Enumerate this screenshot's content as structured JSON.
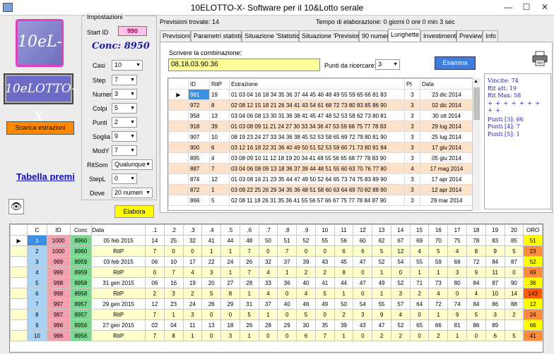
{
  "window": {
    "title": "10ELOTTO-X- Software per il 10&Lotto  serale",
    "minimize": "—",
    "maximize": "☐",
    "close": "✕"
  },
  "logo_top": "10eL-X",
  "conc_label": "Conc: 8950",
  "logo_brand": "10eLOTTO-X",
  "scarica_label": "Scarica estrazioni",
  "tabella_premi": "Tabella premi",
  "eye_icon": "👁",
  "impostazioni": {
    "legend": "Impostazioni",
    "start_id_label": "Start ID",
    "start_id": "990",
    "fields": [
      {
        "label": "Casi",
        "value": "10"
      },
      {
        "label": "Step",
        "value": "7"
      },
      {
        "label": "Numeri",
        "value": "3"
      },
      {
        "label": "Colpi",
        "value": "5"
      },
      {
        "label": "Punti",
        "value": "2"
      },
      {
        "label": "Soglia",
        "value": "9"
      },
      {
        "label": "ModY",
        "value": "7"
      },
      {
        "label": "RitSom",
        "value": "Qualunque"
      },
      {
        "label": "StepL",
        "value": "0"
      },
      {
        "label": "Dove",
        "value": "20 numeri"
      }
    ],
    "elabora": "Elabora"
  },
  "info": {
    "previsioni": "Previsioni trovate: 14",
    "tempo": "Tempo di elaborazione: 0 giorni 0 ore 0 min 3 sec"
  },
  "tabs": [
    "Previsioni",
    "Parametri statistici",
    "Situazione 'Statistici'",
    "Situazione 'Previsioni'",
    "90 numeri",
    "Lunghette",
    "Investimenti",
    "Preview",
    "Info"
  ],
  "lunghette": {
    "combo_label": "Scrivere la combinazione:",
    "combo_value": "08.18.03.90.36",
    "punti_label": "Punti da ricercare:",
    "punti_value": "3",
    "esamina": "Esamina",
    "headers": [
      "ID",
      "RitP",
      "Estrazione",
      "Pt",
      "Data"
    ],
    "rows": [
      [
        "981",
        "19",
        "01 03 04 16 18 34 35 36 37 44 45 46 48 49 55 59 65 66 81 83",
        "3",
        "23 dic 2014"
      ],
      [
        "972",
        "8",
        "02 08 12 15 18 21 26 34 41 43 54 61 68 72 73 80 83 85 86 90",
        "3",
        "02 dic 2014"
      ],
      [
        "958",
        "13",
        "03 04 06 08 13 30 31 36 38 41 45 47 48 52 53 58 62 73 80 81",
        "3",
        "30 ott 2014"
      ],
      [
        "918",
        "39",
        "01 03 08 09 11 21 24 27 30 33 34 36 47 53 59 68 75 77 78 83",
        "3",
        "29 lug 2014"
      ],
      [
        "907",
        "10",
        "08 19 23 24 27 33 34 36 38 45 52 53 58 65 69 72 79 80 81 90",
        "3",
        "25 lug 2014"
      ],
      [
        "900",
        "6",
        "03 12 16 18 22 31 36 40 49 50 51 52 53 59 60 71 73 80 81 84",
        "3",
        "17 giu 2014"
      ],
      [
        "895",
        "4",
        "03 08 09 10 11 12 18 19 20 34 41 48 55 56 65 68 77 78 83 90",
        "3",
        "05 giu 2014"
      ],
      [
        "887",
        "7",
        "03 04 06 08 09 13 18 36 37 39 44 48 51 55 60 63 70 76 77 80",
        "4",
        "17 mag 2014"
      ],
      [
        "874",
        "12",
        "01 03 08 16 21 23 35 44 47 49 50 52 64 65 73 74 75 83 89 90",
        "3",
        "17 apr 2014"
      ],
      [
        "872",
        "1",
        "03 09 22 25 26 29 34 35 36 48 51 58 60 63 64 69 70 82 88 90",
        "3",
        "12 apr 2014"
      ],
      [
        "866",
        "5",
        "02 08 11 18 26 31 35 36 41 55 56 57 66 67 75 77 78 84 87 90",
        "3",
        "29 mar 2014"
      ]
    ]
  },
  "stats": {
    "lines": [
      "Vincite: 74",
      "Rit att: 19",
      "Rit Max: 58",
      "+ + + + + + + + +",
      "Punti [3]: 66",
      "Punti [4]: 7",
      "Punti [5]: 1"
    ]
  },
  "bottom": {
    "headers": [
      "C",
      "ID",
      "Conc",
      "Data",
      ".1",
      ".2",
      ".3",
      ".4",
      ".5",
      ".6",
      ".7",
      ".8",
      ".9",
      "10",
      "11",
      "12",
      "13",
      "14",
      "15",
      "16",
      "17",
      "18",
      "19",
      "20",
      "ORO"
    ],
    "rows": [
      {
        "c": "1",
        "id": "1000",
        "conc": "8960",
        "data": "05 feb 2015",
        "nums": [
          "14",
          "25",
          "32",
          "41",
          "44",
          "48",
          "50",
          "51",
          "52",
          "55",
          "56",
          "60",
          "62",
          "67",
          "69",
          "70",
          "75",
          "78",
          "83",
          "85"
        ],
        "oro": "51",
        "oc": "y",
        "sel": true
      },
      {
        "c": "2",
        "id": "1000",
        "conc": "8960",
        "data": "RitP",
        "nums": [
          "7",
          "0",
          "0",
          "1",
          "1",
          "7",
          "0",
          "7",
          "0",
          "0",
          "6",
          "6",
          "5",
          "12",
          "4",
          "5",
          "4",
          "8",
          "9",
          "5"
        ],
        "oro": "23",
        "oc": "o"
      },
      {
        "c": "3",
        "id": "999",
        "conc": "8959",
        "data": "03 feb 2015",
        "nums": [
          "06",
          "10",
          "17",
          "22",
          "24",
          "26",
          "32",
          "37",
          "39",
          "43",
          "45",
          "47",
          "52",
          "54",
          "55",
          "59",
          "68",
          "72",
          "84",
          "87"
        ],
        "oro": "52",
        "oc": "y"
      },
      {
        "c": "4",
        "id": "999",
        "conc": "8959",
        "data": "RitP",
        "nums": [
          "0",
          "7",
          "4",
          "3",
          "1",
          "7",
          "4",
          "1",
          "2",
          "2",
          "8",
          "0",
          "1",
          "0",
          "1",
          "1",
          "3",
          "9",
          "11",
          "0"
        ],
        "oro": "69",
        "oc": "o"
      },
      {
        "c": "5",
        "id": "998",
        "conc": "8958",
        "data": "31 gen 2015",
        "nums": [
          "06",
          "16",
          "19",
          "20",
          "27",
          "28",
          "33",
          "36",
          "40",
          "41",
          "44",
          "47",
          "49",
          "52",
          "71",
          "73",
          "80",
          "84",
          "87",
          "90"
        ],
        "oro": "36",
        "oc": "y"
      },
      {
        "c": "6",
        "id": "998",
        "conc": "8958",
        "data": "RitP",
        "nums": [
          "2",
          "3",
          "2",
          "5",
          "8",
          "1",
          "4",
          "0",
          "4",
          "5",
          "1",
          "0",
          "1",
          "3",
          "2",
          "4",
          "0",
          "4",
          "10",
          "14"
        ],
        "oro": "143",
        "oc": "r"
      },
      {
        "c": "7",
        "id": "997",
        "conc": "8957",
        "data": "29 gen 2015",
        "nums": [
          "12",
          "23",
          "24",
          "26",
          "29",
          "31",
          "37",
          "40",
          "46",
          "49",
          "50",
          "54",
          "55",
          "57",
          "64",
          "72",
          "74",
          "84",
          "86",
          "88"
        ],
        "oro": "12",
        "oc": "y"
      },
      {
        "c": "8",
        "id": "997",
        "conc": "8957",
        "data": "RitP",
        "nums": [
          "7",
          "1",
          "3",
          "0",
          "0",
          "5",
          "1",
          "0",
          "5",
          "0",
          "2",
          "3",
          "9",
          "4",
          "0",
          "1",
          "9",
          "5",
          "3",
          "2"
        ],
        "oro": "24",
        "oc": "o"
      },
      {
        "c": "9",
        "id": "996",
        "conc": "8956",
        "data": "27 gen 2015",
        "nums": [
          "02",
          "04",
          "11",
          "13",
          "18",
          "26",
          "28",
          "29",
          "30",
          "35",
          "39",
          "43",
          "47",
          "52",
          "65",
          "66",
          "81",
          "86",
          "89"
        ],
        "oro": "66",
        "oc": "y"
      },
      {
        "c": "10",
        "id": "996",
        "conc": "8956",
        "data": "RitP",
        "nums": [
          "7",
          "8",
          "1",
          "0",
          "3",
          "1",
          "0",
          "0",
          "6",
          "7",
          "1",
          "0",
          "2",
          "2",
          "0",
          "2",
          "1",
          "0",
          "6",
          "5"
        ],
        "oro": "41",
        "oc": "o"
      }
    ]
  }
}
